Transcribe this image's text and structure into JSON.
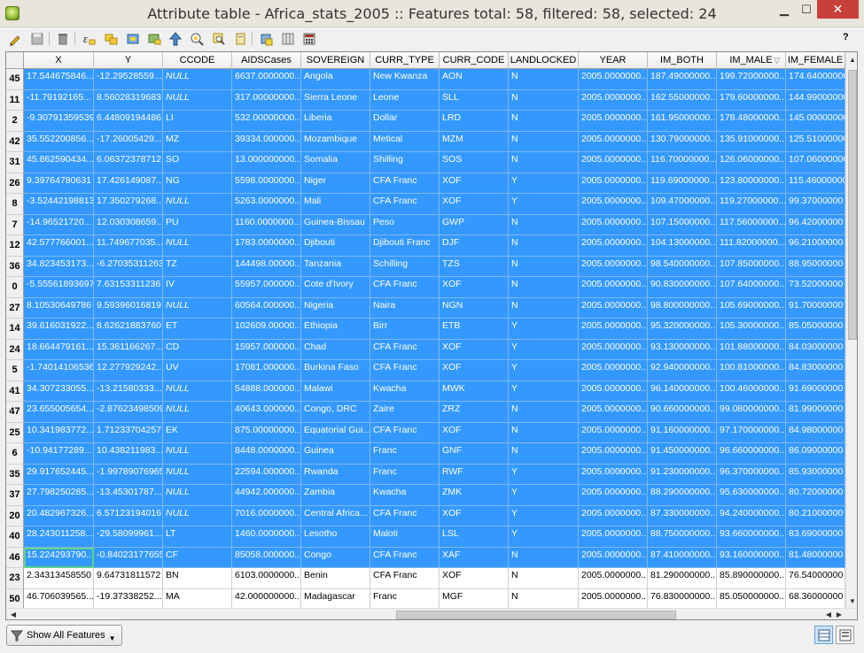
{
  "window": {
    "title": "Attribute table - Africa_stats_2005 :: Features total: 58, filtered: 58, selected: 24",
    "minimize": "▁",
    "maximize": "☐",
    "close": "✕"
  },
  "toolbar": {
    "help": "?",
    "icons": [
      "pencil-icon",
      "save-icon",
      "delete-icon",
      "expression-select-icon",
      "select-all-icon",
      "invert-selection-icon",
      "deselect-icon",
      "move-to-top-icon",
      "pan-to-selection-icon",
      "zoom-to-selection-icon",
      "copy-icon",
      "paste-icon",
      "new-column-icon",
      "delete-column-icon",
      "field-calculator-icon"
    ]
  },
  "table": {
    "columns": [
      {
        "label": "X",
        "w": 79
      },
      {
        "label": "Y",
        "w": 78
      },
      {
        "label": "CCODE",
        "w": 78
      },
      {
        "label": "AIDSCases",
        "w": 78
      },
      {
        "label": "SOVEREIGN",
        "w": 78
      },
      {
        "label": "CURR_TYPE",
        "w": 78
      },
      {
        "label": "CURR_CODE",
        "w": 78
      },
      {
        "label": "LANDLOCKED",
        "w": 79
      },
      {
        "label": "YEAR",
        "w": 78
      },
      {
        "label": "IM_BOTH",
        "w": 78
      },
      {
        "label": "IM_MALE",
        "w": 78
      },
      {
        "label": "IM_FEMALE",
        "w": 67
      }
    ],
    "rows": [
      {
        "id": "45",
        "sel": true,
        "cells": [
          "17.544675846...",
          "-12.29528559...",
          "NULL",
          "6637.0000000...",
          "Angola",
          "New Kwanza",
          "AON",
          "N",
          "2005.0000000...",
          "187.49000000...",
          "199.72000000...",
          "174.64000000"
        ]
      },
      {
        "id": "11",
        "sel": true,
        "cells": [
          "-11.79192165...",
          "8.56028319683",
          "NULL",
          "317.00000000...",
          "Sierra Leone",
          "Leone",
          "SLL",
          "N",
          "2005.0000000...",
          "162.55000000...",
          "179.60000000...",
          "144.99000000"
        ]
      },
      {
        "id": "2",
        "sel": true,
        "cells": [
          "-9.30791359539",
          "6.44809194486",
          "LI",
          "532.00000000...",
          "Liberia",
          "Dollar",
          "LRD",
          "N",
          "2005.0000000...",
          "161.95000000...",
          "178.48000000...",
          "145.00000000"
        ]
      },
      {
        "id": "42",
        "sel": true,
        "cells": [
          "35.552200856...",
          "-17.26005429...",
          "MZ",
          "39334.000000...",
          "Mozambique",
          "Metical",
          "MZM",
          "N",
          "2005.0000000...",
          "130.79000000...",
          "135.91000000...",
          "125.51000000"
        ]
      },
      {
        "id": "31",
        "sel": true,
        "cells": [
          "45.862590434...",
          "6.06372378712",
          "SO",
          "13.000000000...",
          "Somalia",
          "Shilling",
          "SOS",
          "N",
          "2005.0000000...",
          "116.70000000...",
          "126.06000000...",
          "107.06000000"
        ]
      },
      {
        "id": "26",
        "sel": true,
        "cells": [
          "9.39764780631",
          "17.426149087...",
          "NG",
          "5598.0000000...",
          "Niger",
          "CFA Franc",
          "XOF",
          "Y",
          "2005.0000000...",
          "119.69000000...",
          "123.80000000...",
          "115.46000000"
        ]
      },
      {
        "id": "8",
        "sel": true,
        "cells": [
          "-3.52442198813",
          "17.350279268...",
          "NULL",
          "5263.0000000...",
          "Mali",
          "CFA Franc",
          "XOF",
          "Y",
          "2005.0000000...",
          "109.47000000...",
          "119.27000000...",
          "99.37000000"
        ]
      },
      {
        "id": "7",
        "sel": true,
        "cells": [
          "-14.96521720...",
          "12.030308659...",
          "PU",
          "1160.0000000...",
          "Guinea-Bissau",
          "Peso",
          "GWP",
          "N",
          "2005.0000000...",
          "107.15000000...",
          "117.56000000...",
          "96.42000000"
        ]
      },
      {
        "id": "12",
        "sel": true,
        "cells": [
          "42.577766001...",
          "11.749677035...",
          "NULL",
          "1783.0000000...",
          "Djibouti",
          "Djibouti Franc",
          "DJF",
          "N",
          "2005.0000000...",
          "104.13000000...",
          "111.82000000...",
          "96.21000000"
        ]
      },
      {
        "id": "36",
        "sel": true,
        "cells": [
          "34.823453173...",
          "-6.27035311263",
          "TZ",
          "144498.00000...",
          "Tanzania",
          "Schilling",
          "TZS",
          "N",
          "2005.0000000...",
          "98.540000000...",
          "107.85000000...",
          "88.95000000"
        ]
      },
      {
        "id": "0",
        "sel": true,
        "cells": [
          "-5.55561893697",
          "7.63153311236",
          "IV",
          "55957.000000...",
          "Cote d'Ivory",
          "CFA Franc",
          "XOF",
          "N",
          "2005.0000000...",
          "90.830000000...",
          "107.64000000...",
          "73.52000000"
        ]
      },
      {
        "id": "27",
        "sel": true,
        "cells": [
          "8.10530649786",
          "9.59396016819",
          "NULL",
          "60564.000000...",
          "Nigeria",
          "Naira",
          "NGN",
          "N",
          "2005.0000000...",
          "98.800000000...",
          "105.69000000...",
          "91.70000000"
        ]
      },
      {
        "id": "14",
        "sel": true,
        "cells": [
          "39.616031922...",
          "8.62621883760",
          "ET",
          "102609.00000...",
          "Ethiopia",
          "Birr",
          "ETB",
          "Y",
          "2005.0000000...",
          "95.320000000...",
          "105.30000000...",
          "85.05000000"
        ]
      },
      {
        "id": "24",
        "sel": true,
        "cells": [
          "18.664479161...",
          "15.361166267...",
          "CD",
          "15957.000000...",
          "Chad",
          "CFA Franc",
          "XOF",
          "Y",
          "2005.0000000...",
          "93.130000000...",
          "101.88000000...",
          "84.03000000"
        ]
      },
      {
        "id": "5",
        "sel": true,
        "cells": [
          "-1.74014106536",
          "12.277929242...",
          "UV",
          "17081.000000...",
          "Burkina Faso",
          "CFA Franc",
          "XOF",
          "Y",
          "2005.0000000...",
          "92.940000000...",
          "100.81000000...",
          "84.83000000"
        ]
      },
      {
        "id": "41",
        "sel": true,
        "cells": [
          "34.307233055...",
          "-13.21580333...",
          "NULL",
          "54888.000000...",
          "Malawi",
          "Kwacha",
          "MWK",
          "Y",
          "2005.0000000...",
          "96.140000000...",
          "100.46000000...",
          "91.69000000"
        ]
      },
      {
        "id": "47",
        "sel": true,
        "cells": [
          "23.655005654...",
          "-2.87623498509",
          "NULL",
          "40643.000000...",
          "Congo, DRC",
          "Zaire",
          "ZRZ",
          "N",
          "2005.0000000...",
          "90.660000000...",
          "99.080000000...",
          "81.99000000"
        ]
      },
      {
        "id": "25",
        "sel": true,
        "cells": [
          "10.341983772...",
          "1.71233704257",
          "EK",
          "875.00000000...",
          "Equatorial Gui...",
          "CFA Franc",
          "XOF",
          "N",
          "2005.0000000...",
          "91.160000000...",
          "97.170000000...",
          "84.98000000"
        ]
      },
      {
        "id": "6",
        "sel": true,
        "cells": [
          "-10.94177289...",
          "10.438211983...",
          "NULL",
          "8448.0000000...",
          "Guinea",
          "Franc",
          "GNF",
          "N",
          "2005.0000000...",
          "91.450000000...",
          "96.660000000...",
          "86.09000000"
        ]
      },
      {
        "id": "35",
        "sel": true,
        "cells": [
          "29.917652445...",
          "-1.99789076965",
          "NULL",
          "22594.000000...",
          "Rwanda",
          "Franc",
          "RWF",
          "Y",
          "2005.0000000...",
          "91.230000000...",
          "96.370000000...",
          "85.93000000"
        ]
      },
      {
        "id": "37",
        "sel": true,
        "cells": [
          "27.798250285...",
          "-13.45301787...",
          "NULL",
          "44942.000000...",
          "Zambia",
          "Kwacha",
          "ZMK",
          "Y",
          "2005.0000000...",
          "88.290000000...",
          "95.630000000...",
          "80.72000000"
        ]
      },
      {
        "id": "20",
        "sel": true,
        "cells": [
          "20.482967326...",
          "6.57123194016",
          "NULL",
          "7016.0000000...",
          "Central Africa...",
          "CFA Franc",
          "XOF",
          "Y",
          "2005.0000000...",
          "87.330000000...",
          "94.240000000...",
          "80.21000000"
        ]
      },
      {
        "id": "40",
        "sel": true,
        "cells": [
          "28.243011258...",
          "-29.58099961...",
          "LT",
          "1460.0000000...",
          "Lesotho",
          "Maloti",
          "LSL",
          "Y",
          "2005.0000000...",
          "88.750000000...",
          "93.660000000...",
          "83.69000000"
        ]
      },
      {
        "id": "46",
        "sel": true,
        "focus": 0,
        "cells": [
          "15.224293790...",
          "-0.84023177655",
          "CF",
          "85058.000000...",
          "Congo",
          "CFA Franc",
          "XAF",
          "N",
          "2005.0000000...",
          "87.410000000...",
          "93.160000000...",
          "81.48000000"
        ]
      },
      {
        "id": "23",
        "sel": false,
        "cells": [
          "2.34313458550",
          "9.64731811572",
          "BN",
          "6103.0000000...",
          "Benin",
          "CFA Franc",
          "XOF",
          "N",
          "2005.0000000...",
          "81.290000000...",
          "85.890000000...",
          "76.54000000"
        ]
      },
      {
        "id": "50",
        "sel": false,
        "cells": [
          "46.706039565...",
          "-19.37338252...",
          "MA",
          "42.000000000...",
          "Madagascar",
          "Franc",
          "MGF",
          "N",
          "2005.0000000...",
          "76.830000000...",
          "85.050000000...",
          "68.36000000"
        ]
      }
    ]
  },
  "bottom": {
    "show_all": "Show All Features"
  },
  "colors": {
    "selection": "#3399ff",
    "close_button": "#c7413a"
  }
}
